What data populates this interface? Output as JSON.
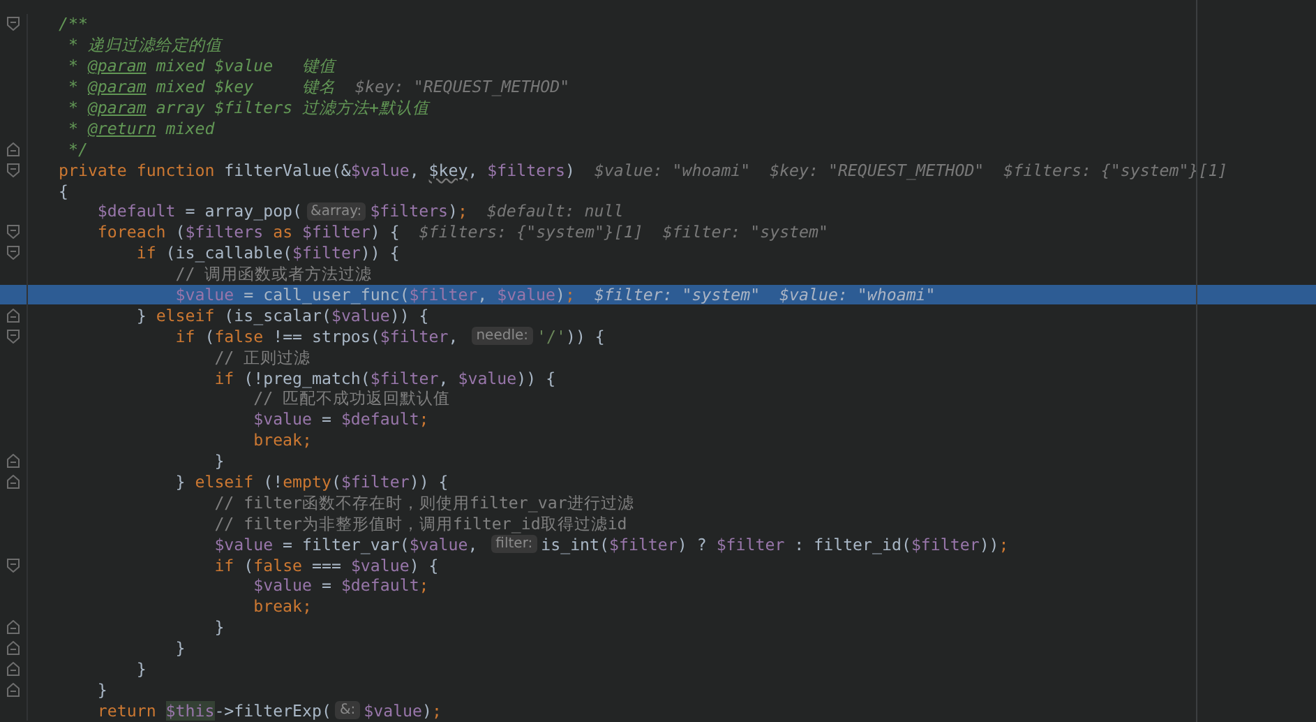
{
  "editor": {
    "lines": [
      {
        "fold_start": true,
        "fold_end": false,
        "highlighted": false,
        "parts": [
          {
            "kind": "code",
            "tokens": [
              {
                "kind": "doc",
                "text": "/**"
              }
            ]
          }
        ]
      },
      {
        "fold_start": false,
        "fold_end": false,
        "highlighted": false,
        "parts": [
          {
            "kind": "code",
            "tokens": [
              {
                "kind": "doc",
                "text": " * 递归过滤给定的值"
              }
            ]
          }
        ]
      },
      {
        "fold_start": false,
        "fold_end": false,
        "highlighted": false,
        "parts": [
          {
            "kind": "code",
            "tokens": [
              {
                "kind": "doc",
                "text": " * "
              },
              {
                "kind": "doctag",
                "text": "@param"
              },
              {
                "kind": "doc",
                "text": " mixed $value   键值"
              }
            ]
          }
        ]
      },
      {
        "fold_start": false,
        "fold_end": false,
        "highlighted": false,
        "parts": [
          {
            "kind": "code",
            "tokens": [
              {
                "kind": "doc",
                "text": " * "
              },
              {
                "kind": "doctag",
                "text": "@param"
              },
              {
                "kind": "doc",
                "text": " mixed $key     键名"
              }
            ]
          }
        ],
        "debug": [
          "$key: \"REQUEST_METHOD\""
        ]
      },
      {
        "fold_start": false,
        "fold_end": false,
        "highlighted": false,
        "parts": [
          {
            "kind": "code",
            "tokens": [
              {
                "kind": "doc",
                "text": " * "
              },
              {
                "kind": "doctag",
                "text": "@param"
              },
              {
                "kind": "doc",
                "text": " array $filters 过滤方法+默认值"
              }
            ]
          }
        ]
      },
      {
        "fold_start": false,
        "fold_end": false,
        "highlighted": false,
        "parts": [
          {
            "kind": "code",
            "tokens": [
              {
                "kind": "doc",
                "text": " * "
              },
              {
                "kind": "doctag",
                "text": "@return"
              },
              {
                "kind": "doc",
                "text": " mixed"
              }
            ]
          }
        ]
      },
      {
        "fold_start": false,
        "fold_end": true,
        "highlighted": false,
        "parts": [
          {
            "kind": "code",
            "tokens": [
              {
                "kind": "doc",
                "text": " */"
              }
            ]
          }
        ]
      },
      {
        "fold_start": true,
        "fold_end": false,
        "highlighted": false,
        "parts": [
          {
            "kind": "code",
            "tokens": [
              {
                "kind": "keyword",
                "text": "private function "
              },
              {
                "kind": "plain",
                "text": "filterValue(&"
              },
              {
                "kind": "variable",
                "text": "$value"
              },
              {
                "kind": "plain",
                "text": ", "
              },
              {
                "kind": "unused",
                "text": "$key"
              },
              {
                "kind": "plain",
                "text": ", "
              },
              {
                "kind": "variable",
                "text": "$filters"
              },
              {
                "kind": "plain",
                "text": ")"
              }
            ]
          }
        ],
        "debug": [
          "$value: \"whoami\"",
          "$key: \"REQUEST_METHOD\"",
          "$filters: {\"system\"}[1]"
        ]
      },
      {
        "fold_start": false,
        "fold_end": false,
        "highlighted": false,
        "parts": [
          {
            "kind": "code",
            "tokens": [
              {
                "kind": "plain",
                "text": "{"
              }
            ]
          }
        ]
      },
      {
        "fold_start": false,
        "fold_end": false,
        "highlighted": false,
        "parts": [
          {
            "kind": "code",
            "tokens": [
              {
                "kind": "variable",
                "text": "    $default"
              },
              {
                "kind": "plain",
                "text": " = array_pop("
              }
            ]
          },
          {
            "kind": "hint",
            "text": "&array:"
          },
          {
            "kind": "code",
            "tokens": [
              {
                "kind": "variable",
                "text": "$filters"
              },
              {
                "kind": "plain",
                "text": ")"
              },
              {
                "kind": "keyword",
                "text": ";"
              }
            ]
          }
        ],
        "debug": [
          "$default: null"
        ]
      },
      {
        "fold_start": true,
        "fold_end": false,
        "highlighted": false,
        "parts": [
          {
            "kind": "code",
            "tokens": [
              {
                "kind": "keyword",
                "text": "    foreach"
              },
              {
                "kind": "plain",
                "text": " ("
              },
              {
                "kind": "variable",
                "text": "$filters"
              },
              {
                "kind": "keyword",
                "text": " as "
              },
              {
                "kind": "variable",
                "text": "$filter"
              },
              {
                "kind": "plain",
                "text": ") {"
              }
            ]
          }
        ],
        "debug": [
          "$filters: {\"system\"}[1]",
          "$filter: \"system\""
        ]
      },
      {
        "fold_start": true,
        "fold_end": false,
        "highlighted": false,
        "parts": [
          {
            "kind": "code",
            "tokens": [
              {
                "kind": "keyword",
                "text": "        if"
              },
              {
                "kind": "plain",
                "text": " (is_callable("
              },
              {
                "kind": "variable",
                "text": "$filter"
              },
              {
                "kind": "plain",
                "text": ")) {"
              }
            ]
          }
        ]
      },
      {
        "fold_start": false,
        "fold_end": false,
        "highlighted": false,
        "parts": [
          {
            "kind": "code",
            "tokens": [
              {
                "kind": "comment",
                "text": "            // 调用函数或者方法过滤"
              }
            ]
          }
        ]
      },
      {
        "fold_start": false,
        "fold_end": false,
        "highlighted": true,
        "parts": [
          {
            "kind": "code",
            "tokens": [
              {
                "kind": "variable",
                "text": "            $value"
              },
              {
                "kind": "plain",
                "text": " = call_user_func("
              },
              {
                "kind": "variable",
                "text": "$filter"
              },
              {
                "kind": "plain",
                "text": ", "
              },
              {
                "kind": "variable",
                "text": "$value"
              },
              {
                "kind": "plain",
                "text": ")"
              },
              {
                "kind": "keyword",
                "text": ";"
              }
            ]
          }
        ],
        "debug": [
          "$filter: \"system\"",
          "$value: \"whoami\""
        ]
      },
      {
        "fold_start": false,
        "fold_end": true,
        "highlighted": false,
        "parts": [
          {
            "kind": "code",
            "tokens": [
              {
                "kind": "plain",
                "text": "        } "
              },
              {
                "kind": "keyword",
                "text": "elseif"
              },
              {
                "kind": "plain",
                "text": " (is_scalar("
              },
              {
                "kind": "variable",
                "text": "$value"
              },
              {
                "kind": "plain",
                "text": ")) {"
              }
            ]
          }
        ]
      },
      {
        "fold_start": true,
        "fold_end": false,
        "highlighted": false,
        "parts": [
          {
            "kind": "code",
            "tokens": [
              {
                "kind": "keyword",
                "text": "            if"
              },
              {
                "kind": "plain",
                "text": " ("
              },
              {
                "kind": "keyword",
                "text": "false"
              },
              {
                "kind": "plain",
                "text": " !== strpos("
              },
              {
                "kind": "variable",
                "text": "$filter"
              },
              {
                "kind": "plain",
                "text": ", "
              }
            ]
          },
          {
            "kind": "hint",
            "text": "needle:"
          },
          {
            "kind": "code",
            "tokens": [
              {
                "kind": "string",
                "text": "'/'"
              },
              {
                "kind": "plain",
                "text": ")) {"
              }
            ]
          }
        ]
      },
      {
        "fold_start": false,
        "fold_end": false,
        "highlighted": false,
        "parts": [
          {
            "kind": "code",
            "tokens": [
              {
                "kind": "comment",
                "text": "                // 正则过滤"
              }
            ]
          }
        ]
      },
      {
        "fold_start": false,
        "fold_end": false,
        "highlighted": false,
        "parts": [
          {
            "kind": "code",
            "tokens": [
              {
                "kind": "keyword",
                "text": "                if"
              },
              {
                "kind": "plain",
                "text": " (!preg_match("
              },
              {
                "kind": "variable",
                "text": "$filter"
              },
              {
                "kind": "plain",
                "text": ", "
              },
              {
                "kind": "variable",
                "text": "$value"
              },
              {
                "kind": "plain",
                "text": ")) {"
              }
            ]
          }
        ]
      },
      {
        "fold_start": false,
        "fold_end": false,
        "highlighted": false,
        "parts": [
          {
            "kind": "code",
            "tokens": [
              {
                "kind": "comment",
                "text": "                    // 匹配不成功返回默认值"
              }
            ]
          }
        ]
      },
      {
        "fold_start": false,
        "fold_end": false,
        "highlighted": false,
        "parts": [
          {
            "kind": "code",
            "tokens": [
              {
                "kind": "variable",
                "text": "                    $value"
              },
              {
                "kind": "plain",
                "text": " = "
              },
              {
                "kind": "variable",
                "text": "$default"
              },
              {
                "kind": "keyword",
                "text": ";"
              }
            ]
          }
        ]
      },
      {
        "fold_start": false,
        "fold_end": false,
        "highlighted": false,
        "parts": [
          {
            "kind": "code",
            "tokens": [
              {
                "kind": "keyword",
                "text": "                    break;"
              }
            ]
          }
        ]
      },
      {
        "fold_start": false,
        "fold_end": true,
        "highlighted": false,
        "parts": [
          {
            "kind": "code",
            "tokens": [
              {
                "kind": "plain",
                "text": "                }"
              }
            ]
          }
        ]
      },
      {
        "fold_start": false,
        "fold_end": true,
        "highlighted": false,
        "parts": [
          {
            "kind": "code",
            "tokens": [
              {
                "kind": "plain",
                "text": "            } "
              },
              {
                "kind": "keyword",
                "text": "elseif"
              },
              {
                "kind": "plain",
                "text": " (!"
              },
              {
                "kind": "keyword",
                "text": "empty"
              },
              {
                "kind": "plain",
                "text": "("
              },
              {
                "kind": "variable",
                "text": "$filter"
              },
              {
                "kind": "plain",
                "text": ")) {"
              }
            ]
          }
        ]
      },
      {
        "fold_start": false,
        "fold_end": false,
        "highlighted": false,
        "parts": [
          {
            "kind": "code",
            "tokens": [
              {
                "kind": "comment",
                "text": "                // filter函数不存在时，则使用filter_var进行过滤"
              }
            ]
          }
        ]
      },
      {
        "fold_start": false,
        "fold_end": false,
        "highlighted": false,
        "parts": [
          {
            "kind": "code",
            "tokens": [
              {
                "kind": "comment",
                "text": "                // filter为非整形值时，调用filter_id取得过滤id"
              }
            ]
          }
        ]
      },
      {
        "fold_start": false,
        "fold_end": false,
        "highlighted": false,
        "parts": [
          {
            "kind": "code",
            "tokens": [
              {
                "kind": "variable",
                "text": "                $value"
              },
              {
                "kind": "plain",
                "text": " = filter_var("
              },
              {
                "kind": "variable",
                "text": "$value"
              },
              {
                "kind": "plain",
                "text": ", "
              }
            ]
          },
          {
            "kind": "hint",
            "text": "filter:"
          },
          {
            "kind": "code",
            "tokens": [
              {
                "kind": "plain",
                "text": "is_int("
              },
              {
                "kind": "variable",
                "text": "$filter"
              },
              {
                "kind": "plain",
                "text": ") ? "
              },
              {
                "kind": "variable",
                "text": "$filter"
              },
              {
                "kind": "plain",
                "text": " : filter_id("
              },
              {
                "kind": "variable",
                "text": "$filter"
              },
              {
                "kind": "plain",
                "text": "))"
              },
              {
                "kind": "keyword",
                "text": ";"
              }
            ]
          }
        ]
      },
      {
        "fold_start": true,
        "fold_end": false,
        "highlighted": false,
        "parts": [
          {
            "kind": "code",
            "tokens": [
              {
                "kind": "keyword",
                "text": "                if"
              },
              {
                "kind": "plain",
                "text": " ("
              },
              {
                "kind": "keyword",
                "text": "false"
              },
              {
                "kind": "plain",
                "text": " === "
              },
              {
                "kind": "variable",
                "text": "$value"
              },
              {
                "kind": "plain",
                "text": ") {"
              }
            ]
          }
        ]
      },
      {
        "fold_start": false,
        "fold_end": false,
        "highlighted": false,
        "parts": [
          {
            "kind": "code",
            "tokens": [
              {
                "kind": "variable",
                "text": "                    $value"
              },
              {
                "kind": "plain",
                "text": " = "
              },
              {
                "kind": "variable",
                "text": "$default"
              },
              {
                "kind": "keyword",
                "text": ";"
              }
            ]
          }
        ]
      },
      {
        "fold_start": false,
        "fold_end": false,
        "highlighted": false,
        "parts": [
          {
            "kind": "code",
            "tokens": [
              {
                "kind": "keyword",
                "text": "                    break;"
              }
            ]
          }
        ]
      },
      {
        "fold_start": false,
        "fold_end": true,
        "highlighted": false,
        "parts": [
          {
            "kind": "code",
            "tokens": [
              {
                "kind": "plain",
                "text": "                }"
              }
            ]
          }
        ]
      },
      {
        "fold_start": false,
        "fold_end": true,
        "highlighted": false,
        "parts": [
          {
            "kind": "code",
            "tokens": [
              {
                "kind": "plain",
                "text": "            }"
              }
            ]
          }
        ]
      },
      {
        "fold_start": false,
        "fold_end": true,
        "highlighted": false,
        "parts": [
          {
            "kind": "code",
            "tokens": [
              {
                "kind": "plain",
                "text": "        }"
              }
            ]
          }
        ]
      },
      {
        "fold_start": false,
        "fold_end": true,
        "highlighted": false,
        "parts": [
          {
            "kind": "code",
            "tokens": [
              {
                "kind": "plain",
                "text": "    }"
              }
            ]
          }
        ]
      },
      {
        "fold_start": false,
        "fold_end": false,
        "highlighted": false,
        "parts": [
          {
            "kind": "code",
            "tokens": [
              {
                "kind": "keyword",
                "text": "    return "
              },
              {
                "kind": "this",
                "text": "$this"
              },
              {
                "kind": "plain",
                "text": "->filterExp("
              }
            ]
          },
          {
            "kind": "hint",
            "text": "&:"
          },
          {
            "kind": "code",
            "tokens": [
              {
                "kind": "variable",
                "text": "$value"
              },
              {
                "kind": "plain",
                "text": ")"
              },
              {
                "kind": "keyword",
                "text": ";"
              }
            ]
          }
        ]
      }
    ]
  }
}
